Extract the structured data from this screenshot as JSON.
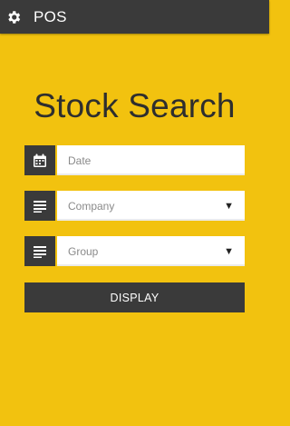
{
  "app_bar": {
    "title": "POS",
    "settings_icon": "gear-icon"
  },
  "form": {
    "heading": "Stock Search",
    "date": {
      "placeholder": "Date",
      "icon": "calendar-icon"
    },
    "company": {
      "selected": "Company",
      "icon": "list-icon"
    },
    "group": {
      "selected": "Group",
      "icon": "list-icon"
    },
    "submit_label": "DISPLAY"
  },
  "colors": {
    "background": "#f2c20f",
    "dark": "#3a3a3a",
    "input_bg": "#ffffff"
  }
}
